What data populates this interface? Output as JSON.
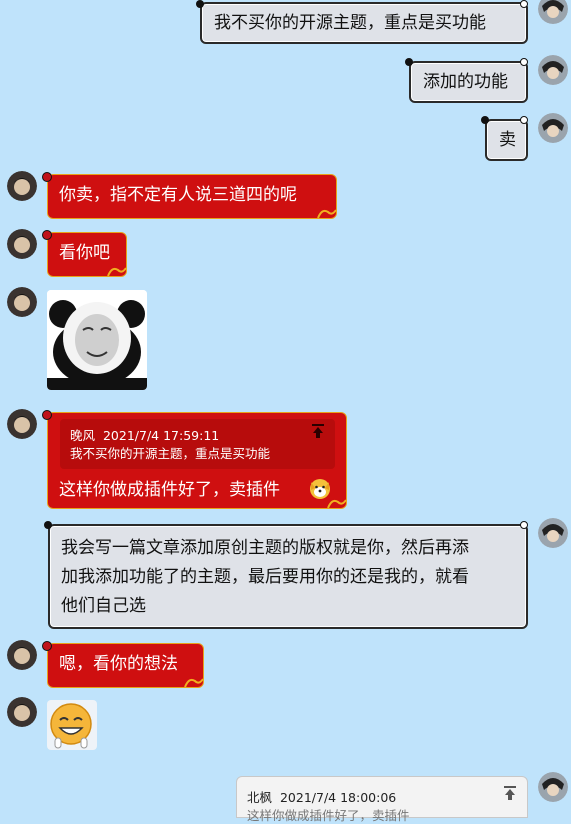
{
  "messages": [
    {
      "side": "right",
      "text": "我不买你的开源主题，重点是买功能"
    },
    {
      "side": "right",
      "text": "添加的功能"
    },
    {
      "side": "right",
      "text": "卖"
    },
    {
      "side": "left",
      "text": "你卖，指不定有人说三道四的呢"
    },
    {
      "side": "left",
      "text": "看你吧"
    },
    {
      "side": "left",
      "sticker": "panda-meme-sticker"
    },
    {
      "side": "left",
      "quote": {
        "author": "晚风",
        "time": "2021/7/4 17:59:11",
        "text": "我不买你的开源主题，重点是买功能"
      },
      "text": "这样你做成插件好了，卖插件"
    },
    {
      "side": "right",
      "lines": [
        "我会写一篇文章添加原创主题的版权就是你，然后再添",
        "加我添加功能了的主题，最后要用你的还是我的，就看",
        "他们自己选"
      ]
    },
    {
      "side": "left",
      "text": "嗯，看你的想法"
    },
    {
      "side": "left",
      "sticker": "smiley-face-sticker"
    },
    {
      "side": "right",
      "quote": {
        "author": "北枫",
        "time": "2021/7/4 18:00:06",
        "text": "这样你做成插件好了，卖插件"
      }
    }
  ],
  "icons": {
    "reply_arrow": "reply-arrow-icon",
    "emoji": "dog-face-emoji"
  },
  "colors": {
    "background": "#bfe3fb",
    "left_bubble": "#cf0f10",
    "right_bubble": "#dfe2e8"
  }
}
